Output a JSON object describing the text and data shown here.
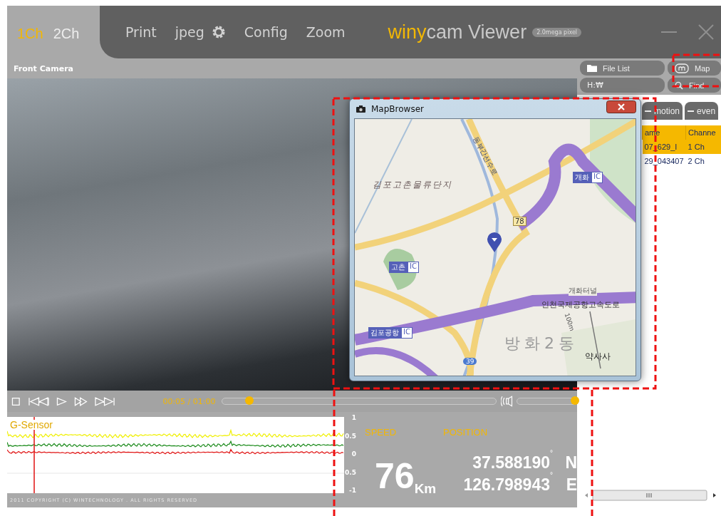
{
  "header": {
    "channels": [
      {
        "label": "1Ch",
        "selected": true
      },
      {
        "label": "2Ch",
        "selected": false
      }
    ],
    "menu": [
      {
        "label": "Print",
        "kind": "text"
      },
      {
        "label": "jpeg",
        "kind": "gear"
      },
      {
        "label": "Config",
        "kind": "text"
      },
      {
        "label": "Zoom",
        "kind": "text"
      }
    ],
    "title_accent": "winy",
    "title_rest": "cam Viewer",
    "badge": "2.0mega pixel"
  },
  "camera_label": "Front Camera",
  "side": {
    "buttons": [
      {
        "label": "File List",
        "kind": "folder"
      },
      {
        "label": "Map",
        "kind": "map"
      }
    ],
    "path": "H:₩",
    "find": "Find",
    "tabs": [
      {
        "label": "motion",
        "selected": false
      },
      {
        "label": "even",
        "selected": false
      }
    ],
    "columns": [
      "ame",
      "Channe"
    ],
    "rows": [
      {
        "cells": [
          "07_629_I",
          "1 Ch"
        ],
        "selected": true
      },
      {
        "cells": [
          "29_043407",
          "2 Ch"
        ],
        "selected": false
      }
    ]
  },
  "map_window": {
    "title": "MapBrowser",
    "labels": [
      {
        "text": "김포고촌물류단지",
        "kind": "area"
      },
      {
        "text": "동부간선수로",
        "kind": "stream"
      },
      {
        "text": "개화",
        "tag": "IC",
        "kind": "ic"
      },
      {
        "text": "78",
        "kind": "route"
      },
      {
        "text": "고촌",
        "tag": "IC",
        "kind": "ic"
      },
      {
        "text": "개화터널",
        "kind": "small"
      },
      {
        "text": "인천국제공항고속도로",
        "kind": "highway"
      },
      {
        "text": "김포공항",
        "tag": "IC",
        "kind": "ic"
      },
      {
        "text": "100m",
        "kind": "trail"
      },
      {
        "text": "방화2동",
        "kind": "district"
      },
      {
        "text": "약사사",
        "kind": "place"
      },
      {
        "text": "39",
        "kind": "shield"
      }
    ]
  },
  "player": {
    "time": "00:05 / 01:00",
    "seek": {
      "level": 0.1
    },
    "volume": {
      "level": 0.97
    }
  },
  "gsensor": {
    "title": "G-Sensor",
    "ticks": [
      "1",
      "0.5",
      "0",
      "0.5",
      "-1"
    ]
  },
  "gps": {
    "speed_label": "SPEED",
    "position_label": "POSITION",
    "speed": "76",
    "unit": "Km",
    "lat": "37.588190",
    "lat_unit": "°",
    "lat_dir": "N",
    "lon": "126.798943",
    "lon_unit": "°",
    "lon_dir": "E"
  },
  "copyright": "2011 COPYRIGHT (C) WINTECHNOLOGY . ALL RIGHTS RESERVED"
}
